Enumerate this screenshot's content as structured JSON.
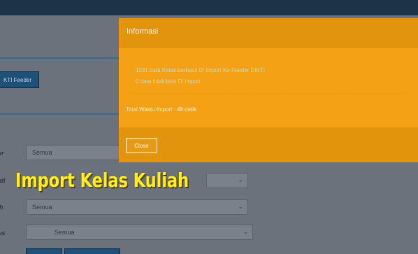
{
  "background": {
    "feeder_button_label": "KTI Feeder",
    "fields": [
      {
        "label": "ter",
        "value": "Semua"
      },
      {
        "label": "odi",
        "value": ""
      },
      {
        "label": "ah",
        "value": "Semua"
      },
      {
        "label": "tus",
        "value": "Semua"
      }
    ]
  },
  "modal": {
    "title": "Informasi",
    "success_message": "1031 data Kelas berhasil Di Import Ke Feeder DIKTI",
    "fail_message": "0 data tidak bisa Di Import",
    "total_time": "Total Waktu Import : 49 detik",
    "close_label": "Close"
  },
  "caption": "Import Kelas Kuliah",
  "colors": {
    "modal_bg": "#f4a115",
    "modal_header": "#e3940d",
    "caption": "#ffeb1a",
    "topbar": "#1d3348"
  }
}
